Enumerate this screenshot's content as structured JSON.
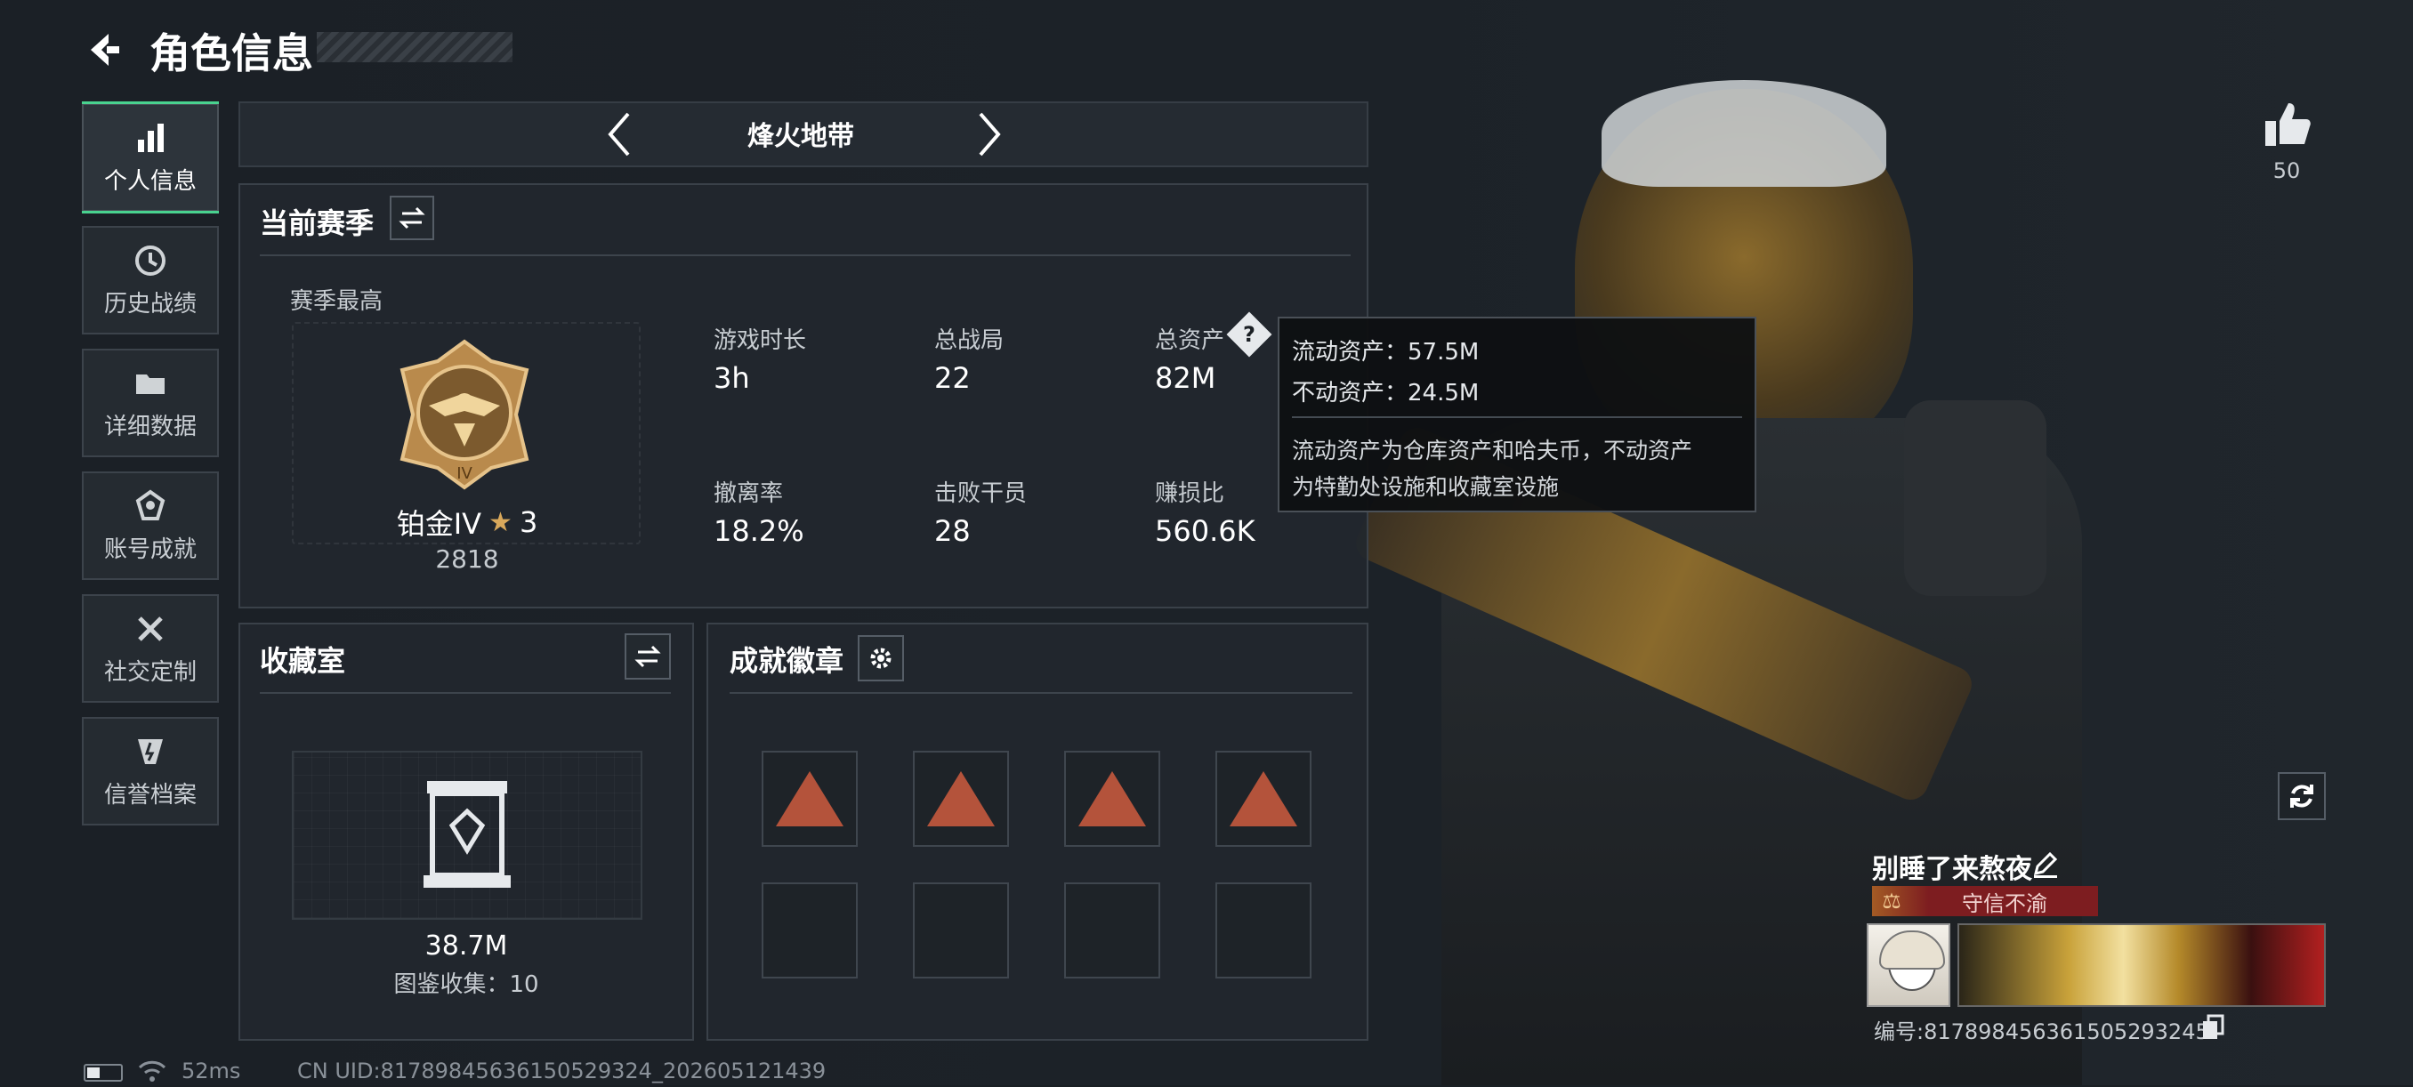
{
  "header": {
    "title": "角色信息"
  },
  "sidebar": {
    "items": [
      {
        "label": "个人信息",
        "icon": "bar-chart-icon",
        "active": true
      },
      {
        "label": "历史战绩",
        "icon": "history-icon"
      },
      {
        "label": "详细数据",
        "icon": "folder-icon"
      },
      {
        "label": "账号成就",
        "icon": "achievement-icon"
      },
      {
        "label": "社交定制",
        "icon": "tools-icon"
      },
      {
        "label": "信誉档案",
        "icon": "credit-icon"
      }
    ]
  },
  "mode_selector": {
    "title": "烽火地带"
  },
  "season": {
    "title": "当前赛季",
    "best_label": "赛季最高",
    "rank_name": "铂金IV",
    "rank_stars": "3",
    "rank_score": "2818",
    "stats": [
      {
        "label": "游戏时长",
        "value": "3h"
      },
      {
        "label": "总战局",
        "value": "22"
      },
      {
        "label": "总资产",
        "value": "82M"
      },
      {
        "label": "撤离率",
        "value": "18.2%"
      },
      {
        "label": "击败干员",
        "value": "28"
      },
      {
        "label": "赚损比",
        "value": "560.6K"
      }
    ]
  },
  "tooltip": {
    "liquid": "流动资产：57.5M",
    "fixed": "不动资产：24.5M",
    "desc_line1": "流动资产为仓库资产和哈夫币，不动资产",
    "desc_line2": "为特勤处设施和收藏室设施"
  },
  "collection": {
    "title": "收藏室",
    "value": "38.7M",
    "count": "图鉴收集：10"
  },
  "badges": {
    "title": "成就徽章"
  },
  "likes": {
    "count": "50"
  },
  "player": {
    "name": "别睡了来熬夜",
    "title": "守信不渝",
    "id_line": "编号:817898456361505293245"
  },
  "status": {
    "ping": "52ms",
    "uid": "CN UID:8178984563615052​9324_202605121439"
  },
  "colors": {
    "accent": "#49d28f",
    "rank_gold": "#d9a85b",
    "title_red": "#7d1d20",
    "badge": "#b4533b"
  }
}
